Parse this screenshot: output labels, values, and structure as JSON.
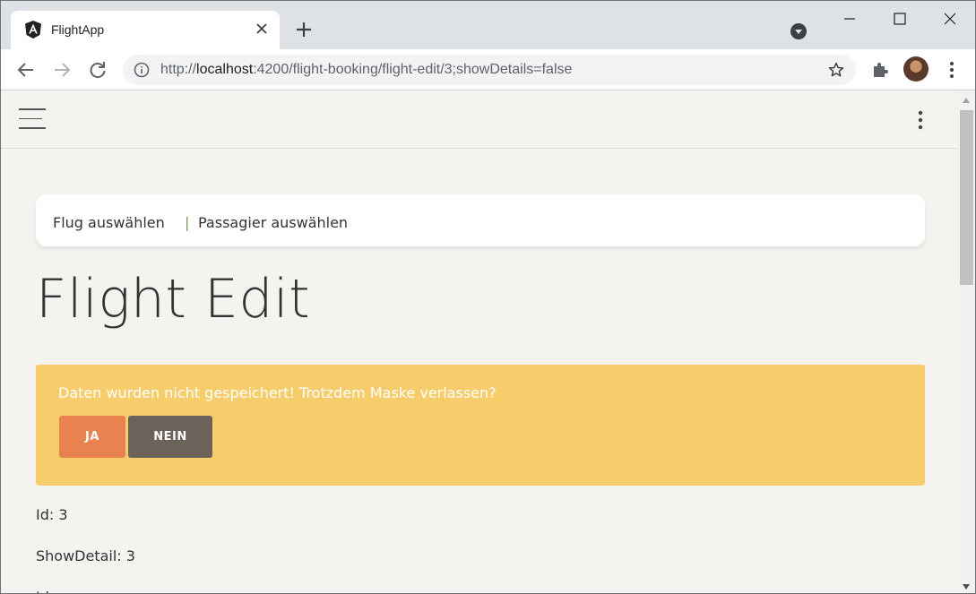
{
  "browser": {
    "tab_title": "FlightApp",
    "url_scheme": "http://",
    "url_host": "localhost",
    "url_rest": ":4200/flight-booking/flight-edit/3;showDetails=false"
  },
  "app": {
    "breadcrumb": {
      "item1": "Flug auswählen",
      "separator": "|",
      "item2": "Passagier auswählen"
    },
    "title": "Flight Edit",
    "alert": {
      "message": "Daten wurden nicht gespeichert! Trotzdem Maske verlassen?",
      "yes_label": "JA",
      "no_label": "NEIN"
    },
    "fields": {
      "id": "Id: 3",
      "show_detail": "ShowDetail: 3",
      "partial": "Id"
    }
  },
  "colors": {
    "alert_bg": "#f7cd6b",
    "yes_button": "#e8834f",
    "no_button": "#6b635a"
  }
}
